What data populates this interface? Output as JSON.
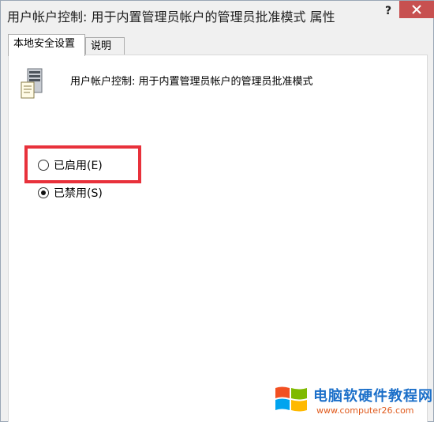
{
  "window": {
    "title": "用户帐户控制: 用于内置管理员帐户的管理员批准模式 属性",
    "help_label": "?"
  },
  "tabs": [
    {
      "label": "本地安全设置",
      "active": true
    },
    {
      "label": "说明",
      "active": false
    }
  ],
  "policy": {
    "icon": "server-policy-icon",
    "name": "用户帐户控制: 用于内置管理员帐户的管理员批准模式"
  },
  "options": [
    {
      "label": "已启用(E)",
      "checked": false
    },
    {
      "label": "已禁用(S)",
      "checked": true
    }
  ],
  "highlight": {
    "color": "#e8313b"
  },
  "watermark": {
    "title": "电脑软硬件教程网",
    "url": "www.computer26.com"
  },
  "colors": {
    "close_button": "#c75050",
    "watermark_title": "#1b6fc9",
    "watermark_url": "#e05a1c"
  }
}
